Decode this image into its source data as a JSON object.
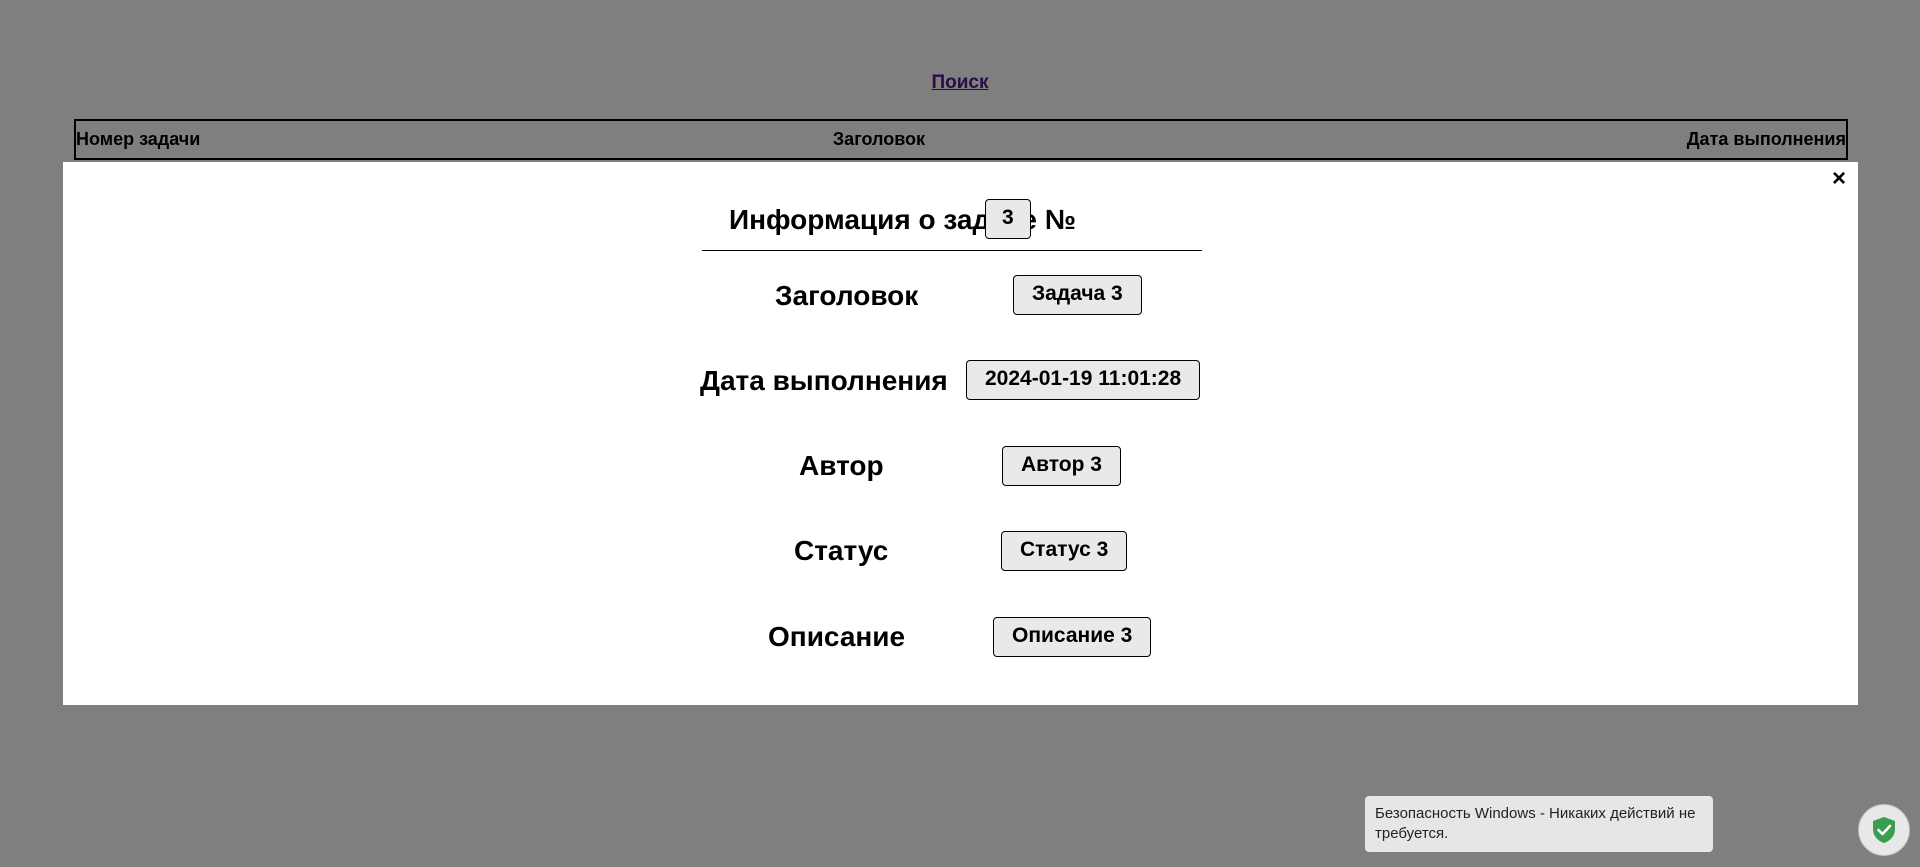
{
  "page": {
    "search_link": "Поиск",
    "table_headers": [
      "Номер задачи",
      "Заголовок",
      "Дата выполнения"
    ]
  },
  "modal": {
    "close_label": "×",
    "title": "Информация о задаче №",
    "task_number": "3",
    "fields": [
      {
        "label": "Заголовок",
        "value": "Задача 3"
      },
      {
        "label": "Дата выполнения",
        "value": "2024-01-19 11:01:28"
      },
      {
        "label": "Автор",
        "value": "Автор 3"
      },
      {
        "label": "Статус",
        "value": "Статус 3"
      },
      {
        "label": "Описание",
        "value": "Описание 3"
      }
    ]
  },
  "toast": {
    "text": "Безопасность Windows - Никаких действий не требуется.",
    "icon": "shield-check-icon",
    "accent_color": "#3a9e4f"
  }
}
